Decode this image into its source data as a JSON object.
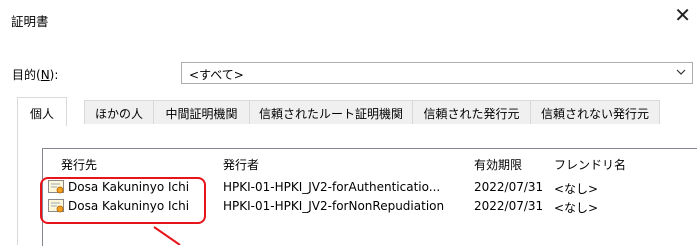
{
  "window": {
    "title": "証明書",
    "close_icon": "close-x-icon"
  },
  "purpose": {
    "label_prefix": "目的(",
    "label_key": "N",
    "label_suffix": "):",
    "selected": "<すべて>",
    "arrow_icon": "chevron-down-icon"
  },
  "tabs": [
    {
      "label": "個人",
      "active": true
    },
    {
      "label": "ほかの人",
      "active": false
    },
    {
      "label": "中間証明機関",
      "active": false
    },
    {
      "label": "信頼されたルート証明機関",
      "active": false
    },
    {
      "label": "信頼された発行元",
      "active": false
    },
    {
      "label": "信頼されない発行元",
      "active": false
    }
  ],
  "table": {
    "columns": [
      "発行先",
      "発行者",
      "有効期限",
      "フレンドリ名"
    ],
    "rows": [
      {
        "issued_to": "Dosa Kakuninyo Ichi",
        "issued_by": "HPKI-01-HPKI_JV2-forAuthenticatio...",
        "expires": "2022/07/31",
        "friendly_name": "<なし>",
        "icon": "certificate-icon"
      },
      {
        "issued_to": "Dosa Kakuninyo Ichi",
        "issued_by": "HPKI-01-HPKI_JV2-forNonRepudiation",
        "expires": "2022/07/31",
        "friendly_name": "<なし>",
        "icon": "certificate-icon"
      }
    ]
  },
  "annotation": {
    "color": "#e8141b",
    "caption": ""
  }
}
